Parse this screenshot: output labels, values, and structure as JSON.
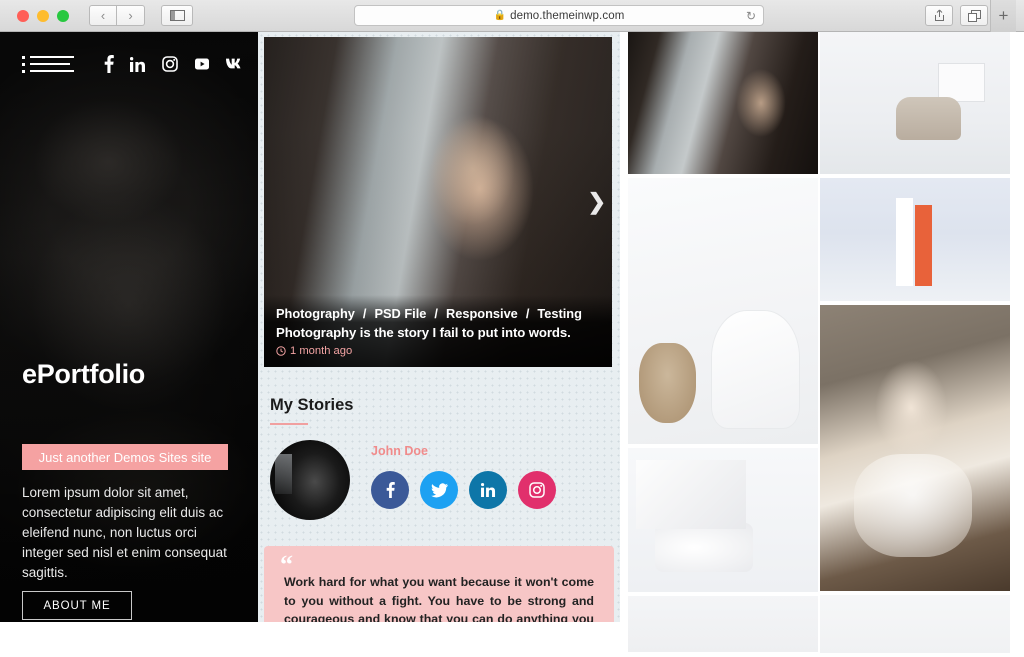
{
  "browser": {
    "back_label": "‹",
    "forward_label": "›",
    "sidebar_icon": "sidebar-toggle-icon",
    "url": "demo.themeinwp.com",
    "lock_icon": "lock-icon",
    "reload_icon": "reload-icon",
    "share_icon": "share-icon",
    "tabs_icon": "tab-overview-icon",
    "new_tab_label": "+"
  },
  "sidebar": {
    "menu_icon": "hamburger-list-icon",
    "social": [
      {
        "name": "facebook",
        "glyph": "f"
      },
      {
        "name": "linkedin",
        "glyph": "in"
      },
      {
        "name": "instagram",
        "glyph": "◉"
      },
      {
        "name": "youtube",
        "glyph": "▶"
      },
      {
        "name": "vk",
        "glyph": "vk"
      }
    ],
    "site_title": "ePortfolio",
    "tagline": "Just another Demos Sites site",
    "description": "Lorem ipsum dolor sit amet, consectetur adipiscing elit duis ac eleifend nunc, non luctus orci integer sed nisl et enim consequat sagittis.",
    "about_button": "ABOUT ME"
  },
  "featured": {
    "categories": [
      "Photography",
      "PSD File",
      "Responsive",
      "Testing"
    ],
    "separator": "/",
    "title": "Photography is the story I fail to put into words.",
    "clock_icon": "clock-icon",
    "time": "1 month ago",
    "next_label": "❯"
  },
  "stories": {
    "heading": "My Stories",
    "author": "John Doe",
    "avatar_name": "author-avatar",
    "social": [
      {
        "name": "facebook",
        "glyph": "f",
        "color": "#3b5998"
      },
      {
        "name": "twitter",
        "glyph": "🐦",
        "color": "#1da1f2"
      },
      {
        "name": "linkedin",
        "glyph": "in",
        "color": "#0e76a8"
      },
      {
        "name": "instagram",
        "glyph": "◉",
        "color": "#e1306c"
      }
    ]
  },
  "quote": {
    "mark": "“",
    "text": "Work hard for what you want because it won't come to you without a fight. You have to be strong and courageous and know that you can do anything you put your mind to. If somebody puts you down or"
  },
  "gallery": {
    "left_column": [
      "gallery-window-photo",
      "gallery-chair-photo",
      "gallery-lamp-photo",
      "gallery-blank-photo"
    ],
    "right_column": [
      "gallery-desk-photo",
      "gallery-books-photo",
      "gallery-girl-photo",
      "gallery-blank-photo-2"
    ]
  },
  "colors": {
    "accent_pink": "#f1a0a0",
    "quote_bg": "#f7c6c6",
    "sidebar_bg": "#0a0a0a",
    "page_bg": "#e8eef1"
  }
}
